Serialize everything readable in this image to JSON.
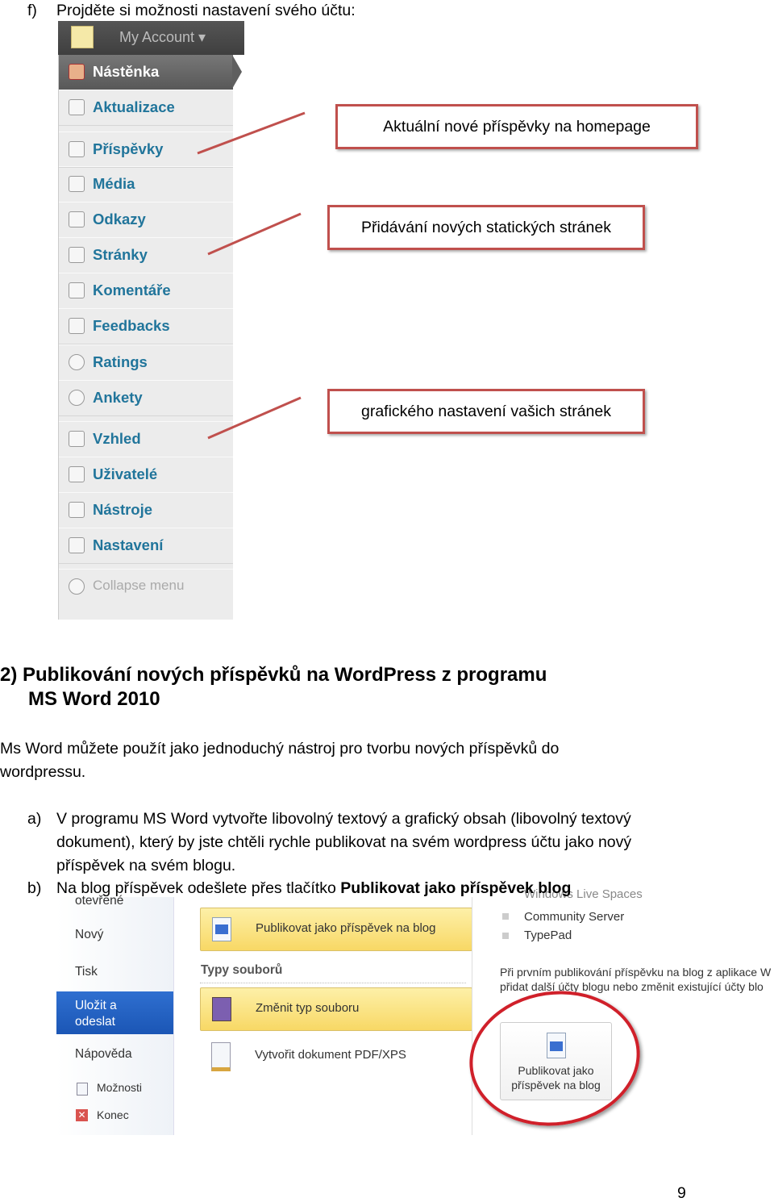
{
  "step_f": {
    "marker": "f)",
    "text": "Projděte si možnosti nastavení svého účtu:"
  },
  "wp_admin": {
    "account_label": "My Account ▾",
    "menu": [
      {
        "label": "Nástěnka",
        "icon": "home-icon"
      },
      {
        "label": "Aktualizace",
        "icon": "gear-icon"
      },
      {
        "label": "Příspěvky",
        "icon": "pushpin-icon"
      },
      {
        "label": "Média",
        "icon": "media-icon"
      },
      {
        "label": "Odkazy",
        "icon": "link-icon"
      },
      {
        "label": "Stránky",
        "icon": "pages-icon"
      },
      {
        "label": "Komentáře",
        "icon": "comment-icon"
      },
      {
        "label": "Feedbacks",
        "icon": "feedback-icon"
      },
      {
        "label": "Ratings",
        "icon": "circle-icon"
      },
      {
        "label": "Ankety",
        "icon": "circle-icon"
      },
      {
        "label": "Vzhled",
        "icon": "appearance-icon"
      },
      {
        "label": "Uživatelé",
        "icon": "users-icon"
      },
      {
        "label": "Nástroje",
        "icon": "tools-icon"
      },
      {
        "label": "Nastavení",
        "icon": "settings-icon"
      }
    ],
    "collapse_label": "Collapse menu"
  },
  "callouts": [
    "Aktuální nové příspěvky na homepage",
    "Přidávání nových statických stránek",
    "grafického nastavení vašich stránek"
  ],
  "callout_color": "#c0504d",
  "section2": {
    "heading_line1": "2)  Publikování nových příspěvků na WordPress z programu",
    "heading_line2": "MS Word 2010"
  },
  "intro": {
    "line1": "Ms Word můžete použít jako jednoduchý nástroj pro tvorbu nových příspěvků do",
    "line2": "wordpressu."
  },
  "list": {
    "a_marker": "a)",
    "a_line1": "V programu MS Word vytvořte libovolný textový a grafický obsah (libovolný textový",
    "a_line2": "dokument), který by jste chtěli rychle publikovat na svém wordpress účtu jako nový",
    "a_line3": "příspěvek na svém blogu.",
    "b_marker": "b)",
    "b_text": "Na blog příspěvek odešlete přes tlačítko ",
    "b_bold": "Publikovat jako příspěvek blog"
  },
  "word": {
    "left": {
      "cut_top": "otevřené",
      "new": "Nový",
      "print": "Tisk",
      "save_send": "Uložit a odeslat",
      "help": "Nápověda",
      "options": "Možnosti",
      "exit": "Konec"
    },
    "publish_blog": "Publikovat jako příspěvek na blog",
    "file_types": "Typy souborů",
    "change_type": "Změnit typ souboru",
    "create_pdf": "Vytvořit dokument PDF/XPS",
    "services": [
      "Windows Live Spaces",
      "Community Server",
      "TypePad"
    ],
    "info_line1": "Při prvním publikování příspěvku na blog z aplikace W",
    "info_line2": "přidat další účty blogu nebo změnit existující účty blo",
    "big_button": "Publikovat jako příspěvek na blog",
    "accent": "#1b56b5"
  },
  "page_number": "9"
}
